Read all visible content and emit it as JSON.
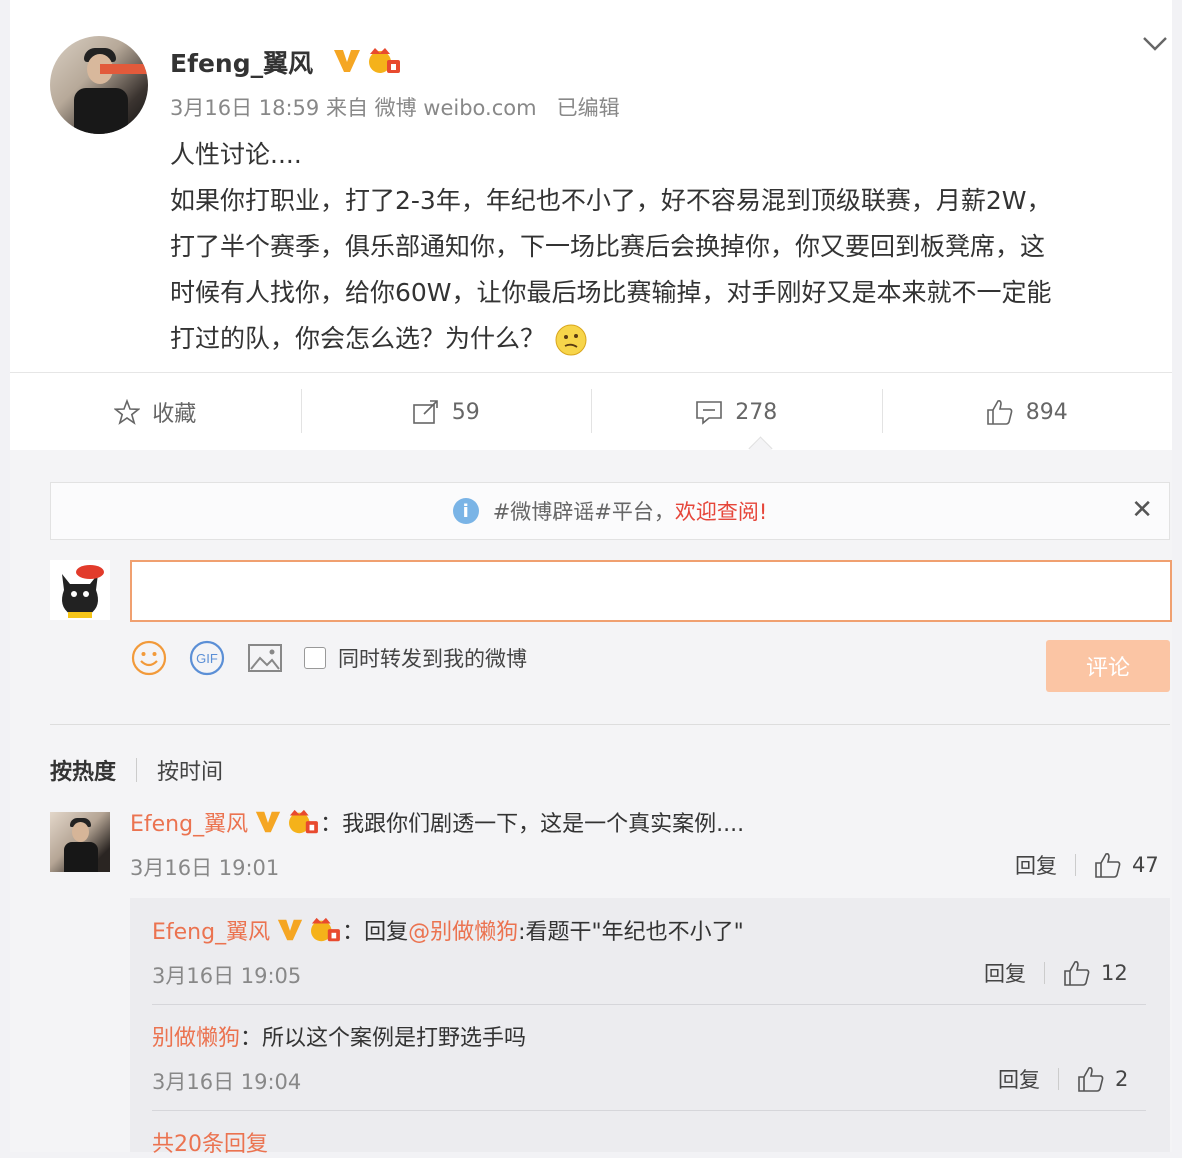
{
  "post": {
    "username": "Efeng_翼风",
    "meta": "3月16日 18:59 来自 微博 weibo.com",
    "edited": "已编辑",
    "title_line": "人性讨论....",
    "body_line1": "如果你打职业，打了2-3年，年纪也不小了，好不容易混到顶级联赛，月薪2W，",
    "body_line2": "打了半个赛季，俱乐部通知你，下一场比赛后会换掉你，你又要回到板凳席，这",
    "body_line3": "时候有人找你，给你60W，让你最后场比赛输掉，对手刚好又是本来就不一定能",
    "body_line4": "打过的队，你会怎么选？为什么？"
  },
  "actions": {
    "favorite": "收藏",
    "repost_count": "59",
    "comment_count": "278",
    "like_count": "894"
  },
  "notice": {
    "text": "#微博辟谣#平台，",
    "link": "欢迎查阅!"
  },
  "composer": {
    "placeholder": "",
    "checkbox_label": "同时转发到我的微博",
    "submit_label": "评论"
  },
  "sort": {
    "hot": "按热度",
    "time": "按时间"
  },
  "comment": {
    "username": "Efeng_翼风",
    "text": "：我跟你们剧透一下，这是一个真实案例....",
    "time": "3月16日 19:01",
    "reply_label": "回复",
    "likes": "47"
  },
  "replies": [
    {
      "username": "Efeng_翼风",
      "prefix": "：回复",
      "mention": "@别做懒狗",
      "text": ":看题干\"年纪也不小了\"",
      "time": "3月16日 19:05",
      "reply_label": "回复",
      "likes": "12"
    },
    {
      "username": "别做懒狗",
      "text": "：所以这个案例是打野选手吗",
      "time": "3月16日 19:04",
      "reply_label": "回复",
      "likes": "2"
    }
  ],
  "more_replies": "共20条回复",
  "colors": {
    "accent_orange": "#eb7350",
    "verified_gold": "#f5a623",
    "button_disabled": "#fbc5a4"
  }
}
